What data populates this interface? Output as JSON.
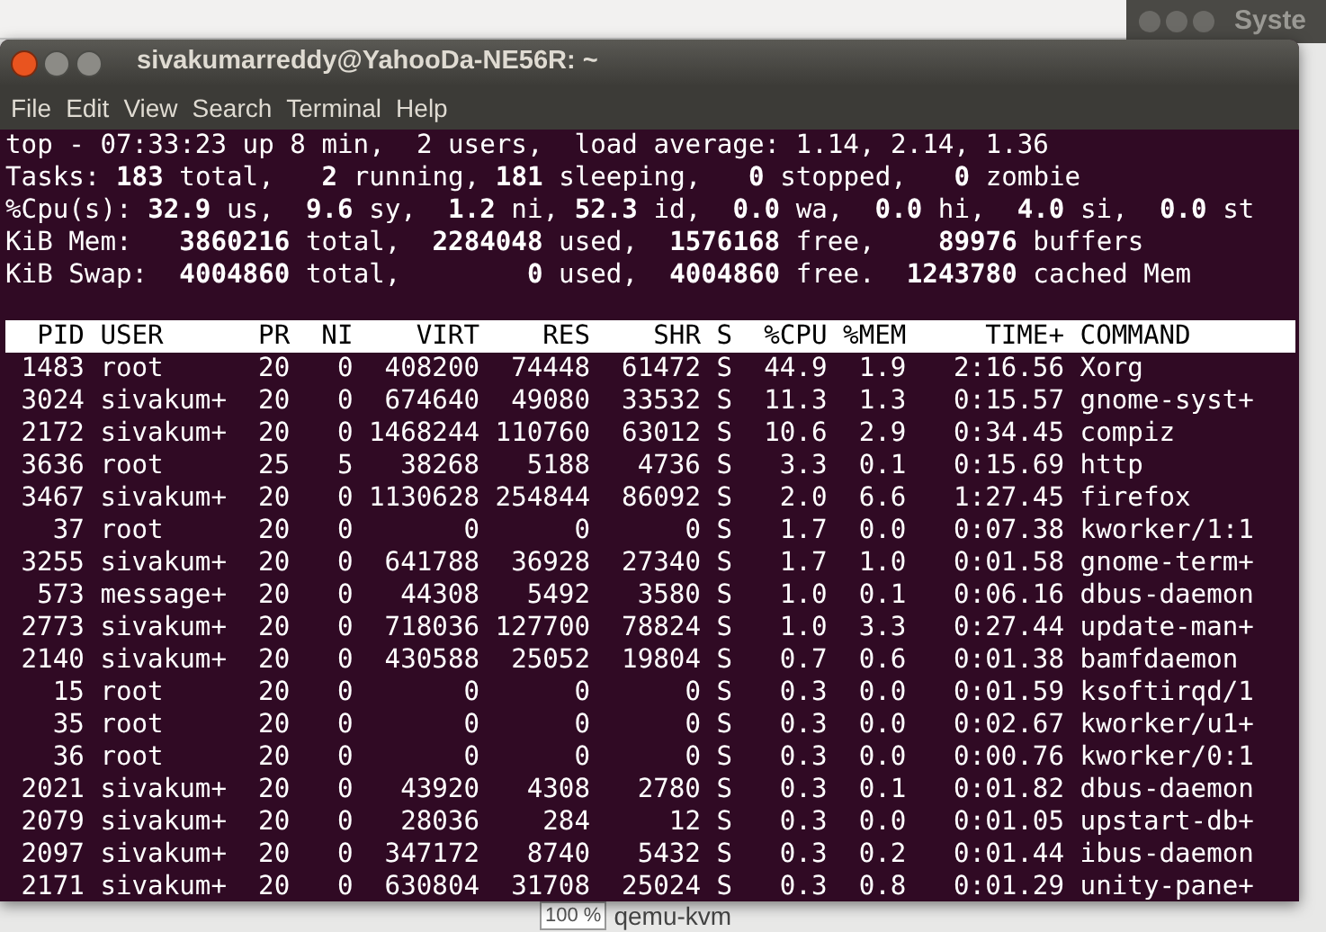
{
  "background_window": {
    "title": "Syste"
  },
  "background_list": {
    "percent": "100 %",
    "process": "qemu-kvm"
  },
  "terminal": {
    "title": "sivakumarreddy@YahooDa-NE56R: ~",
    "menu": [
      "File",
      "Edit",
      "View",
      "Search",
      "Terminal",
      "Help"
    ],
    "summary": [
      "top - 07:33:23 up 8 min,  2 users,  load average: 1.14, 2.14, 1.36",
      "Tasks: **183** total,   **2** running, **181** sleeping,   **0** stopped,   **0** zombie",
      "%Cpu(s): **32.9** us,  **9.6** sy,  **1.2** ni, **52.3** id,  **0.0** wa,  **0.0** hi,  **4.0** si,  **0.0** st",
      "KiB Mem:   **3860216** total,  **2284048** used,  **1576168** free,    **89976** buffers",
      "KiB Swap:  **4004860** total,        **0** used,  **4004860** free.  **1243780** cached Mem"
    ],
    "table": {
      "columns": [
        "PID",
        "USER",
        "PR",
        "NI",
        "VIRT",
        "RES",
        "SHR",
        "S",
        "%CPU",
        "%MEM",
        "TIME+",
        "COMMAND"
      ],
      "rows": [
        [
          "1483",
          "root",
          "20",
          "0",
          "408200",
          "74448",
          "61472",
          "S",
          "44.9",
          "1.9",
          "2:16.56",
          "Xorg"
        ],
        [
          "3024",
          "sivakum+",
          "20",
          "0",
          "674640",
          "49080",
          "33532",
          "S",
          "11.3",
          "1.3",
          "0:15.57",
          "gnome-syst+"
        ],
        [
          "2172",
          "sivakum+",
          "20",
          "0",
          "1468244",
          "110760",
          "63012",
          "S",
          "10.6",
          "2.9",
          "0:34.45",
          "compiz"
        ],
        [
          "3636",
          "root",
          "25",
          "5",
          "38268",
          "5188",
          "4736",
          "S",
          "3.3",
          "0.1",
          "0:15.69",
          "http"
        ],
        [
          "3467",
          "sivakum+",
          "20",
          "0",
          "1130628",
          "254844",
          "86092",
          "S",
          "2.0",
          "6.6",
          "1:27.45",
          "firefox"
        ],
        [
          "37",
          "root",
          "20",
          "0",
          "0",
          "0",
          "0",
          "S",
          "1.7",
          "0.0",
          "0:07.38",
          "kworker/1:1"
        ],
        [
          "3255",
          "sivakum+",
          "20",
          "0",
          "641788",
          "36928",
          "27340",
          "S",
          "1.7",
          "1.0",
          "0:01.58",
          "gnome-term+"
        ],
        [
          "573",
          "message+",
          "20",
          "0",
          "44308",
          "5492",
          "3580",
          "S",
          "1.0",
          "0.1",
          "0:06.16",
          "dbus-daemon"
        ],
        [
          "2773",
          "sivakum+",
          "20",
          "0",
          "718036",
          "127700",
          "78824",
          "S",
          "1.0",
          "3.3",
          "0:27.44",
          "update-man+"
        ],
        [
          "2140",
          "sivakum+",
          "20",
          "0",
          "430588",
          "25052",
          "19804",
          "S",
          "0.7",
          "0.6",
          "0:01.38",
          "bamfdaemon"
        ],
        [
          "15",
          "root",
          "20",
          "0",
          "0",
          "0",
          "0",
          "S",
          "0.3",
          "0.0",
          "0:01.59",
          "ksoftirqd/1"
        ],
        [
          "35",
          "root",
          "20",
          "0",
          "0",
          "0",
          "0",
          "S",
          "0.3",
          "0.0",
          "0:02.67",
          "kworker/u1+"
        ],
        [
          "36",
          "root",
          "20",
          "0",
          "0",
          "0",
          "0",
          "S",
          "0.3",
          "0.0",
          "0:00.76",
          "kworker/0:1"
        ],
        [
          "2021",
          "sivakum+",
          "20",
          "0",
          "43920",
          "4308",
          "2780",
          "S",
          "0.3",
          "0.1",
          "0:01.82",
          "dbus-daemon"
        ],
        [
          "2079",
          "sivakum+",
          "20",
          "0",
          "28036",
          "284",
          "12",
          "S",
          "0.3",
          "0.0",
          "0:01.05",
          "upstart-db+"
        ],
        [
          "2097",
          "sivakum+",
          "20",
          "0",
          "347172",
          "8740",
          "5432",
          "S",
          "0.3",
          "0.2",
          "0:01.44",
          "ibus-daemon"
        ],
        [
          "2171",
          "sivakum+",
          "20",
          "0",
          "630804",
          "31708",
          "25024",
          "S",
          "0.3",
          "0.8",
          "0:01.29",
          "unity-pane+"
        ]
      ]
    }
  }
}
